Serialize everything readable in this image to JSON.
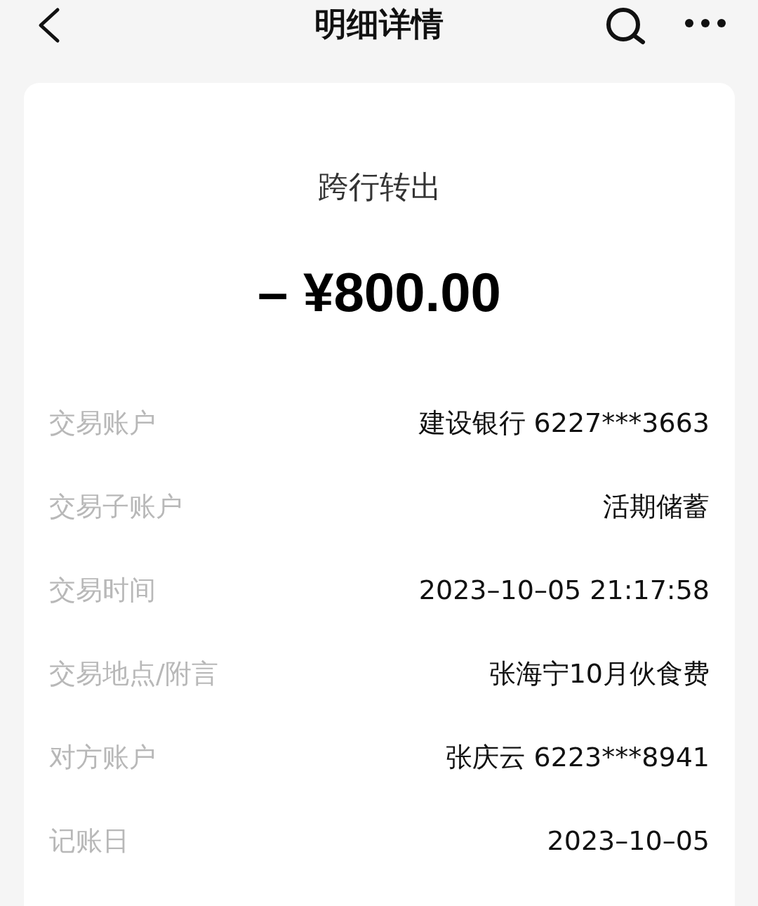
{
  "header": {
    "title": "明细详情"
  },
  "summary": {
    "type_label": "跨行转出",
    "amount": "– ¥800.00"
  },
  "details": [
    {
      "label": "交易账户",
      "value": "建设银行 6227***3663"
    },
    {
      "label": "交易子账户",
      "value": "活期储蓄"
    },
    {
      "label": "交易时间",
      "value": "2023–10–05 21:17:58"
    },
    {
      "label": "交易地点/附言",
      "value": "张海宁10月伙食费"
    },
    {
      "label": "对方账户",
      "value": "张庆云 6223***8941"
    },
    {
      "label": "记账日",
      "value": "2023–10–05"
    }
  ]
}
